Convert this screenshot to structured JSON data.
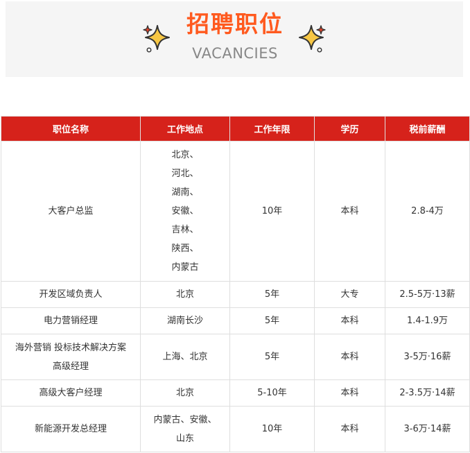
{
  "banner": {
    "title": "招聘职位",
    "subtitle": "VACANCIES"
  },
  "colors": {
    "title": "#ff5a1f",
    "header_bg": "#d6221b",
    "sparkle_fill": "#f7c744",
    "sparkle_stroke": "#333333",
    "banner_bg": "#f5f5f5"
  },
  "icons": {
    "left": "sparkle-icon",
    "right": "sparkle-icon"
  },
  "table": {
    "headers": [
      "职位名称",
      "工作地点",
      "工作年限",
      "学历",
      "税前薪酬"
    ],
    "rows": [
      {
        "position": "大客户总监",
        "locations": [
          "北京、",
          "河北、",
          "湖南、",
          "安徽、",
          "吉林、",
          "陕西、",
          "内蒙古"
        ],
        "years": "10年",
        "education": "本科",
        "salary": "2.8-4万"
      },
      {
        "position": "开发区域负责人",
        "locations": [
          "北京"
        ],
        "years": "5年",
        "education": "大专",
        "salary": "2.5-5万·13薪"
      },
      {
        "position": "电力营销经理",
        "locations": [
          "湖南长沙"
        ],
        "years": "5年",
        "education": "本科",
        "salary": "1.4-1.9万"
      },
      {
        "position": [
          "海外营销 投标技术解决方案",
          "高级经理"
        ],
        "locations": [
          "上海、北京"
        ],
        "years": "5年",
        "education": "本科",
        "salary": "3-5万·16薪"
      },
      {
        "position": "高级大客户经理",
        "locations": [
          "北京"
        ],
        "years": "5-10年",
        "education": "本科",
        "salary": "2-3.5万·14薪"
      },
      {
        "position": "新能源开发总经理",
        "locations": [
          "内蒙古、安徽、",
          "山东"
        ],
        "years": "10年",
        "education": "本科",
        "salary": "3-6万·14薪"
      }
    ]
  }
}
